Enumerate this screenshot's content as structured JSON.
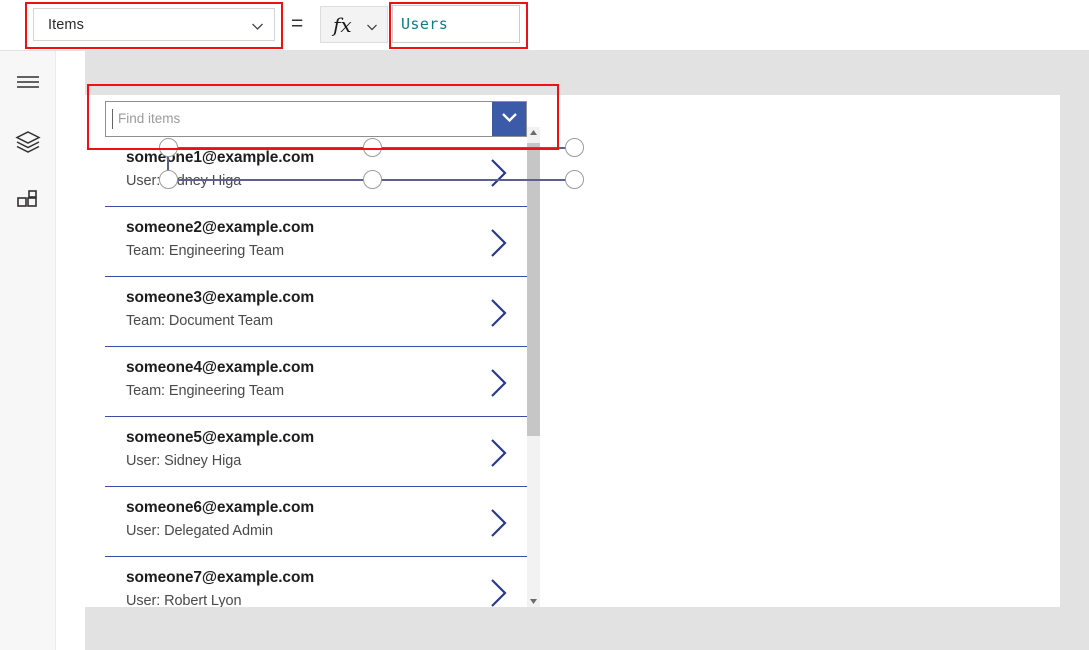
{
  "formula_bar": {
    "property_dropdown": {
      "selected": "Items",
      "chevron_icon": "chevron-down-icon"
    },
    "equals": "=",
    "fx_button": {
      "glyph": "fx",
      "chevron_icon": "chevron-down-icon"
    },
    "formula_input": {
      "value": "Users"
    }
  },
  "left_rail": {
    "items": [
      {
        "name": "menu-icon",
        "label": "Menu"
      },
      {
        "name": "layers-icon",
        "label": "Tree view"
      },
      {
        "name": "components-icon",
        "label": "Insert"
      }
    ]
  },
  "combobox": {
    "search_placeholder": "Find items",
    "toggle_icon": "chevron-down-icon",
    "toggle_color": "#3b5ba9",
    "separator_color": "#3b4ea2",
    "chevron_color": "#2b3a8c",
    "items": [
      {
        "primary": "someone1@example.com",
        "secondary": "User: Sidney Higa"
      },
      {
        "primary": "someone2@example.com",
        "secondary": "Team: Engineering Team"
      },
      {
        "primary": "someone3@example.com",
        "secondary": "Team: Document Team"
      },
      {
        "primary": "someone4@example.com",
        "secondary": "Team: Engineering Team"
      },
      {
        "primary": "someone5@example.com",
        "secondary": "User: Sidney Higa"
      },
      {
        "primary": "someone6@example.com",
        "secondary": "User: Delegated Admin"
      },
      {
        "primary": "someone7@example.com",
        "secondary": "User: Robert Lyon"
      }
    ]
  },
  "scrollbar": {
    "up_arrow_icon": "caret-up-icon",
    "down_arrow_icon": "caret-down-icon"
  },
  "annotations": {
    "highlight_color": "#ee1111",
    "boxes": [
      {
        "name": "property-dropdown-highlight"
      },
      {
        "name": "formula-input-highlight"
      },
      {
        "name": "combobox-highlight"
      }
    ]
  }
}
